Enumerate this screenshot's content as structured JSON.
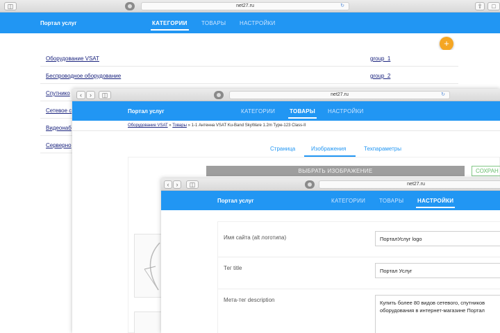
{
  "browser": {
    "url": "net27.ru"
  },
  "app": {
    "brand": "Портал услуг",
    "nav": {
      "categories": "КАТЕГОРИИ",
      "products": "ТОВАРЫ",
      "settings": "НАСТРОЙКИ"
    }
  },
  "categories_window": {
    "add_icon": "+",
    "rows": [
      {
        "name": "Оборудование VSAT",
        "group": "group_1"
      },
      {
        "name": "Беспроводное оборудование",
        "group": "group_2"
      },
      {
        "name": "Спутнико",
        "group": ""
      },
      {
        "name": "Сетевое с",
        "group": ""
      },
      {
        "name": "Видеонаб",
        "group": ""
      },
      {
        "name": "Серверно",
        "group": ""
      }
    ]
  },
  "product_window": {
    "breadcrumb": {
      "first": "Оборудование VSAT",
      "sep1": "»",
      "second": "Товары",
      "sep2": "»",
      "current": "1-1 Антенна VSAT Ku-Band SkyWare 1.2m Type-123 Class-II"
    },
    "tabs": [
      "Страница",
      "Изображения",
      "Техпараметры"
    ],
    "choose_image_label": "ВЫБРАТЬ ИЗОБРАЖЕНИЕ",
    "save_label": "СОХРАН"
  },
  "settings_window": {
    "fields": [
      {
        "label": "Имя сайта (alt логотипа)",
        "value": "ПорталУслуг logo"
      },
      {
        "label": "Тег title",
        "value": "Портал Услуг"
      },
      {
        "label": "Мета-тег description",
        "value": "Купить более 80 видов сетевого, спутников оборудования в интернет-магазине Портал"
      }
    ]
  },
  "colors": {
    "accent": "#2196f3",
    "fab": "#f5a623",
    "link": "#1a237e"
  }
}
